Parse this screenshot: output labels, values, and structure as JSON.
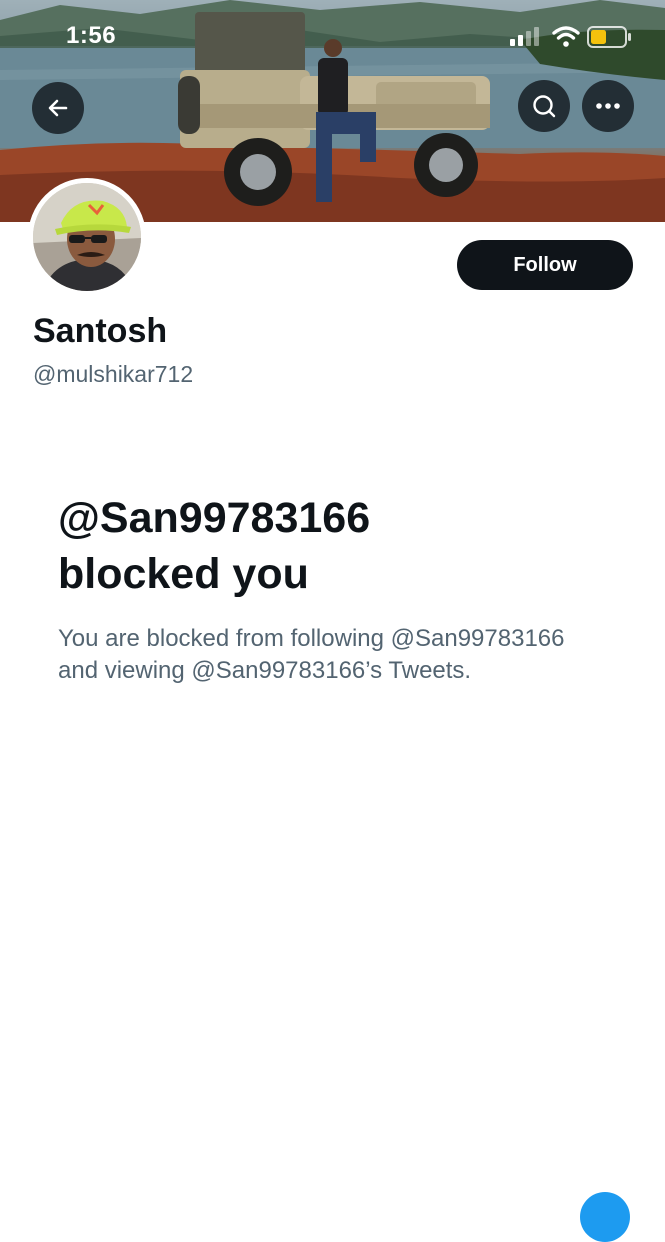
{
  "status_bar": {
    "time": "1:56",
    "icons": [
      "cellular-signal-icon",
      "wifi-icon",
      "battery-icon"
    ],
    "battery_color": "#f4c20d"
  },
  "header": {
    "buttons": [
      "back-arrow-icon",
      "search-icon",
      "more-icon"
    ]
  },
  "profile": {
    "display_name": "Santosh",
    "handle": "@mulshikar712",
    "follow_label": "Follow"
  },
  "blocked": {
    "title_line1": "@San99783166",
    "title_line2": "blocked you",
    "desc_line1": "You are blocked from following @San99783166",
    "desc_line2": "and viewing @San99783166’s Tweets."
  },
  "colors": {
    "primary_text": "#0f1419",
    "secondary_text": "#536471",
    "follow_bg": "#0f1419",
    "accent": "#1d9bf0"
  }
}
